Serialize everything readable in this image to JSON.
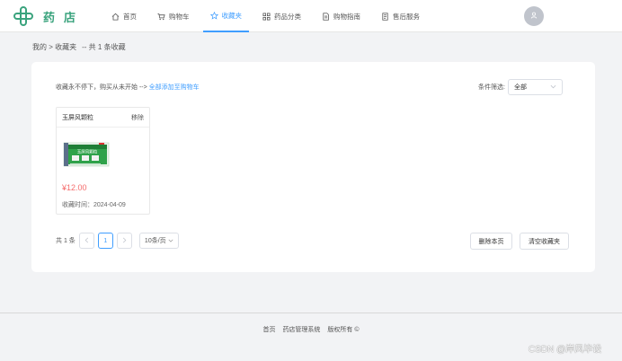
{
  "header": {
    "logo_text": "药店",
    "nav": [
      {
        "label": "首页",
        "icon": "home-icon"
      },
      {
        "label": "购物车",
        "icon": "cart-icon"
      },
      {
        "label": "收藏夹",
        "icon": "star-icon",
        "active": true
      },
      {
        "label": "药品分类",
        "icon": "grid-icon"
      },
      {
        "label": "购物指南",
        "icon": "document-icon"
      },
      {
        "label": "售后服务",
        "icon": "service-icon"
      }
    ]
  },
  "breadcrumb": {
    "path": "我的 > 收藏夹",
    "count": "-- 共 1 条收藏"
  },
  "toolbar": {
    "tip_prefix": "收藏永不停下，购买从未开始 -->",
    "tip_link": "全部添加至购物车",
    "filter_label": "条件筛选:",
    "filter_value": "全部"
  },
  "items": [
    {
      "name": "玉屏风颗粒",
      "remove_label": "移除",
      "price": "¥12.00",
      "fav_time": "收藏时间：2024-04-09",
      "package_text": "玉屏风颗粒"
    }
  ],
  "pagination": {
    "total": "共 1 条",
    "current_page": "1",
    "page_size": "10条/页"
  },
  "actions": {
    "delete_page": "删除本页",
    "clear_all": "清空收藏夹"
  },
  "footer": {
    "links": [
      "首页",
      "药店管理系统",
      "版权所有 ©"
    ]
  },
  "watermark": "CSDN @岸风毕设",
  "colors": {
    "accent": "#409eff",
    "brand": "#3aa37d",
    "price": "#f56c6c",
    "background": "#f2f3f5"
  }
}
